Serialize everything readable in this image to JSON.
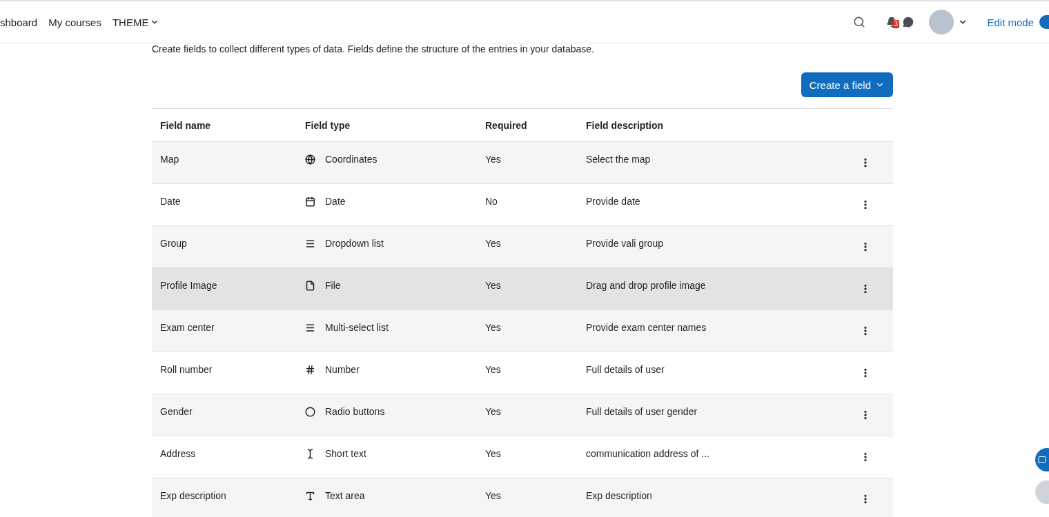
{
  "nav": {
    "links": [
      {
        "label": "shboard",
        "selected": false
      },
      {
        "label": "My courses",
        "selected": false
      },
      {
        "label": "THEME",
        "selected": false,
        "kind": "dropdown"
      }
    ],
    "notification_count": "3",
    "edit_mode": {
      "label": "Edit mode",
      "on": true
    }
  },
  "intro": "Create fields to collect different types of data. Fields define the structure of the entries in your database.",
  "create_button": "Create a field",
  "table": {
    "columns": [
      "Field name",
      "Field type",
      "Required",
      "Field description"
    ],
    "rows": [
      {
        "name": "Map",
        "type": "Coordinates",
        "kind": "globe",
        "required": "Yes",
        "description": "Select the map",
        "hovered": false
      },
      {
        "name": "Date",
        "type": "Date",
        "kind": "calendar",
        "required": "No",
        "description": "Provide date",
        "hovered": false
      },
      {
        "name": "Group",
        "type": "Dropdown list",
        "kind": "list",
        "required": "Yes",
        "description": "Provide vali group",
        "hovered": false
      },
      {
        "name": "Profile Image",
        "type": "File",
        "kind": "file",
        "required": "Yes",
        "description": "Drag and drop profile image",
        "hovered": true
      },
      {
        "name": "Exam center",
        "type": "Multi-select list",
        "kind": "list",
        "required": "Yes",
        "description": "Provide exam center names",
        "hovered": false
      },
      {
        "name": "Roll number",
        "type": "Number",
        "kind": "hash",
        "required": "Yes",
        "description": "Full details of user",
        "hovered": false
      },
      {
        "name": "Gender",
        "type": "Radio buttons",
        "kind": "circle",
        "required": "Yes",
        "description": "Full details of user gender",
        "hovered": false
      },
      {
        "name": "Address",
        "type": "Short text",
        "kind": "cursor",
        "required": "Yes",
        "description": "communication address of ...",
        "hovered": false
      },
      {
        "name": "Exp description",
        "type": "Text area",
        "kind": "letter",
        "required": "Yes",
        "description": "Exp description",
        "hovered": false
      }
    ]
  }
}
